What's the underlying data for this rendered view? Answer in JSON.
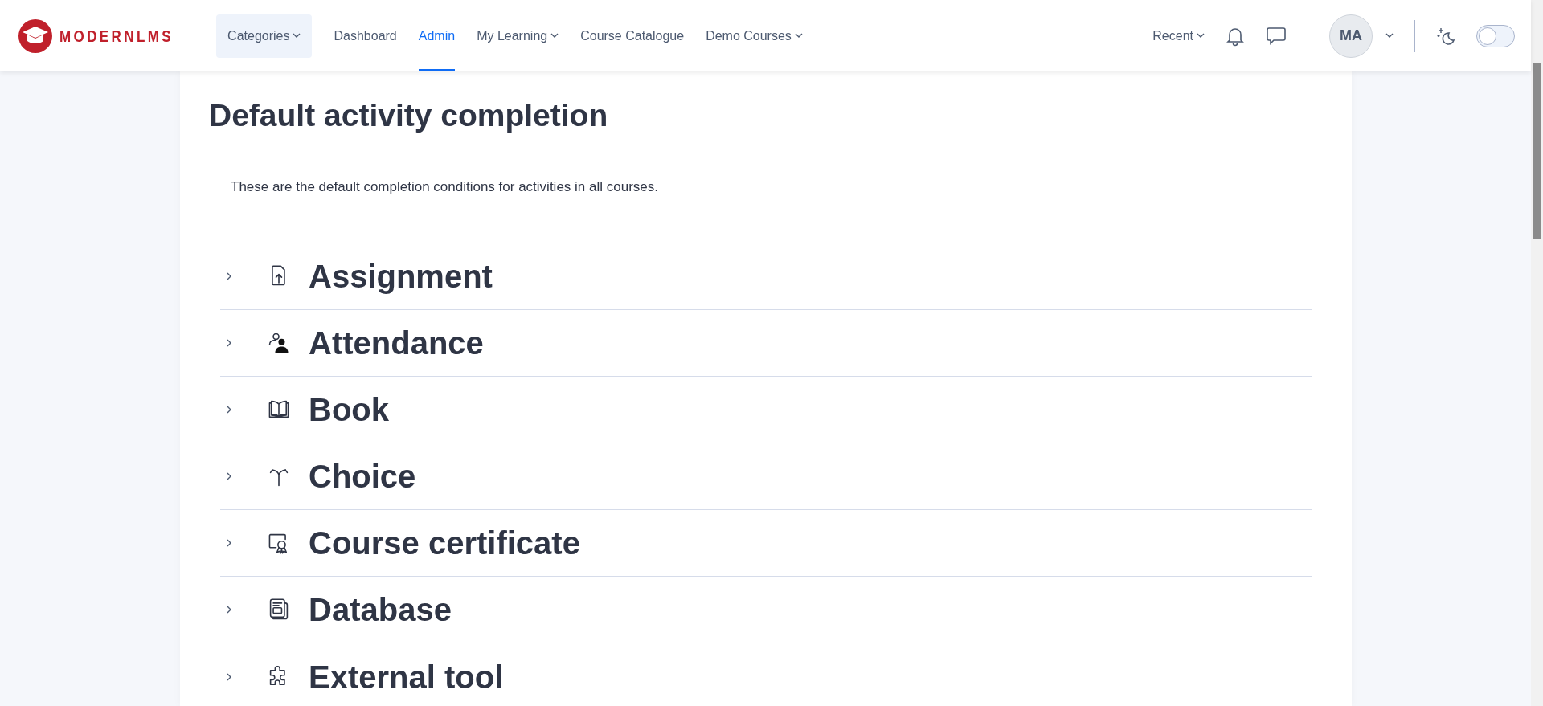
{
  "navbar": {
    "logo": "MODERNLMS",
    "categories": {
      "label": "Categories",
      "dropdown": true
    },
    "items": [
      {
        "label": "Dashboard",
        "selected": false,
        "dropdown": false
      },
      {
        "label": "Admin",
        "selected": true,
        "dropdown": false
      },
      {
        "label": "My Learning",
        "selected": false,
        "dropdown": true
      },
      {
        "label": "Course Catalogue",
        "selected": false,
        "dropdown": false
      },
      {
        "label": "Demo Courses",
        "selected": false,
        "dropdown": true
      }
    ],
    "recent": {
      "label": "Recent",
      "dropdown": true
    },
    "avatar": "MA",
    "dark_mode": {
      "on": false
    }
  },
  "page": {
    "title": "Default activity completion",
    "description": "These are the default completion conditions for activities in all courses.",
    "activities": [
      {
        "name": "Assignment",
        "kind": "assignment",
        "expanded": false
      },
      {
        "name": "Attendance",
        "kind": "attendance",
        "expanded": false
      },
      {
        "name": "Book",
        "kind": "book",
        "expanded": false
      },
      {
        "name": "Choice",
        "kind": "choice",
        "expanded": false
      },
      {
        "name": "Course certificate",
        "kind": "certificate",
        "expanded": false
      },
      {
        "name": "Database",
        "kind": "database",
        "expanded": false
      },
      {
        "name": "External tool",
        "kind": "tool",
        "expanded": false
      }
    ]
  }
}
